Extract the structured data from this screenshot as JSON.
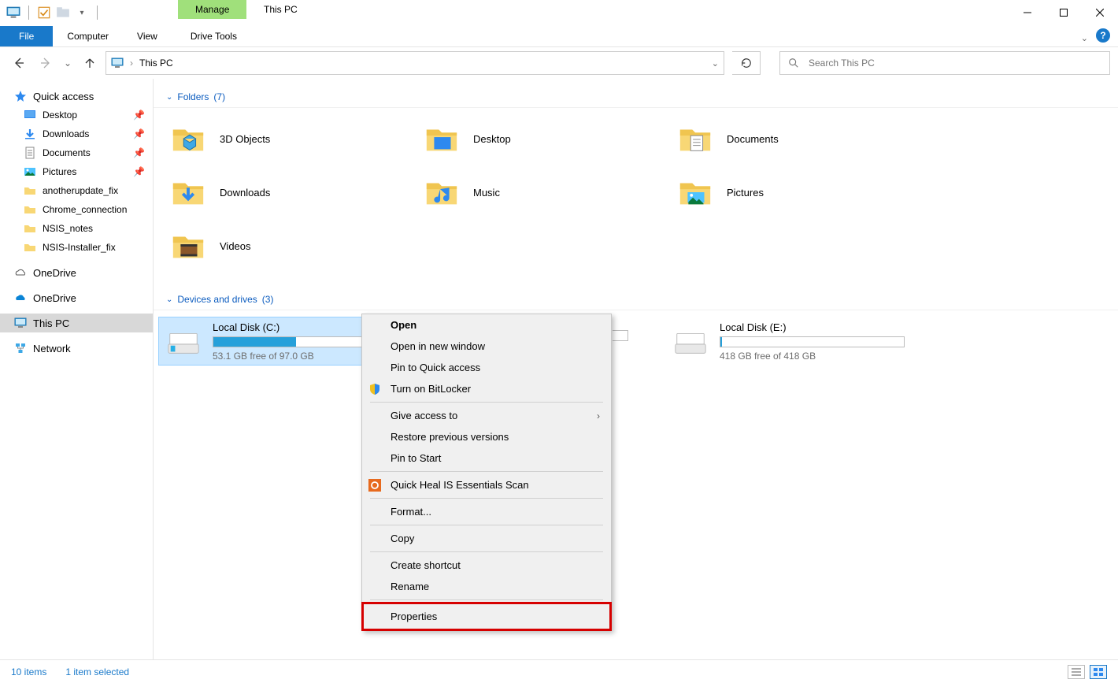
{
  "titlebar": {
    "context_tab": "Manage",
    "title": "This PC"
  },
  "ribbon": {
    "file": "File",
    "tabs": [
      "Computer",
      "View",
      "Drive Tools"
    ]
  },
  "addressbar": {
    "location": "This PC",
    "dropdown_hint": "v"
  },
  "search": {
    "placeholder": "Search This PC"
  },
  "sidebar": {
    "quick_access": "Quick access",
    "items": [
      {
        "label": "Desktop",
        "pinned": true
      },
      {
        "label": "Downloads",
        "pinned": true
      },
      {
        "label": "Documents",
        "pinned": true
      },
      {
        "label": "Pictures",
        "pinned": true
      },
      {
        "label": "anotherupdate_fix",
        "pinned": false
      },
      {
        "label": "Chrome_connection",
        "pinned": false
      },
      {
        "label": "NSIS_notes",
        "pinned": false
      },
      {
        "label": "NSIS-Installer_fix",
        "pinned": false
      }
    ],
    "onedrive1": "OneDrive",
    "onedrive2": "OneDrive",
    "this_pc": "This PC",
    "network": "Network"
  },
  "sections": {
    "folders": {
      "label": "Folders",
      "count": "(7)"
    },
    "devices": {
      "label": "Devices and drives",
      "count": "(3)"
    }
  },
  "folders": [
    "3D Objects",
    "Desktop",
    "Documents",
    "Downloads",
    "Music",
    "Pictures",
    "Videos"
  ],
  "drives": [
    {
      "name": "Local Disk (C:)",
      "free": "53.1 GB free of 97.0 GB",
      "fill_pct": 45,
      "selected": true
    },
    {
      "name": "",
      "free": "",
      "fill_pct": 0,
      "selected": false,
      "hidden_by_menu": true
    },
    {
      "name": "Local Disk (E:)",
      "free": "418 GB free of 418 GB",
      "fill_pct": 1,
      "selected": false
    }
  ],
  "context_menu": {
    "open": "Open",
    "open_new_window": "Open in new window",
    "pin_quick_access": "Pin to Quick access",
    "bitlocker": "Turn on BitLocker",
    "give_access": "Give access to",
    "restore_previous": "Restore previous versions",
    "pin_start": "Pin to Start",
    "quickheal": "Quick Heal IS Essentials Scan",
    "format": "Format...",
    "copy": "Copy",
    "create_shortcut": "Create shortcut",
    "rename": "Rename",
    "properties": "Properties"
  },
  "statusbar": {
    "items": "10 items",
    "selected": "1 item selected"
  }
}
